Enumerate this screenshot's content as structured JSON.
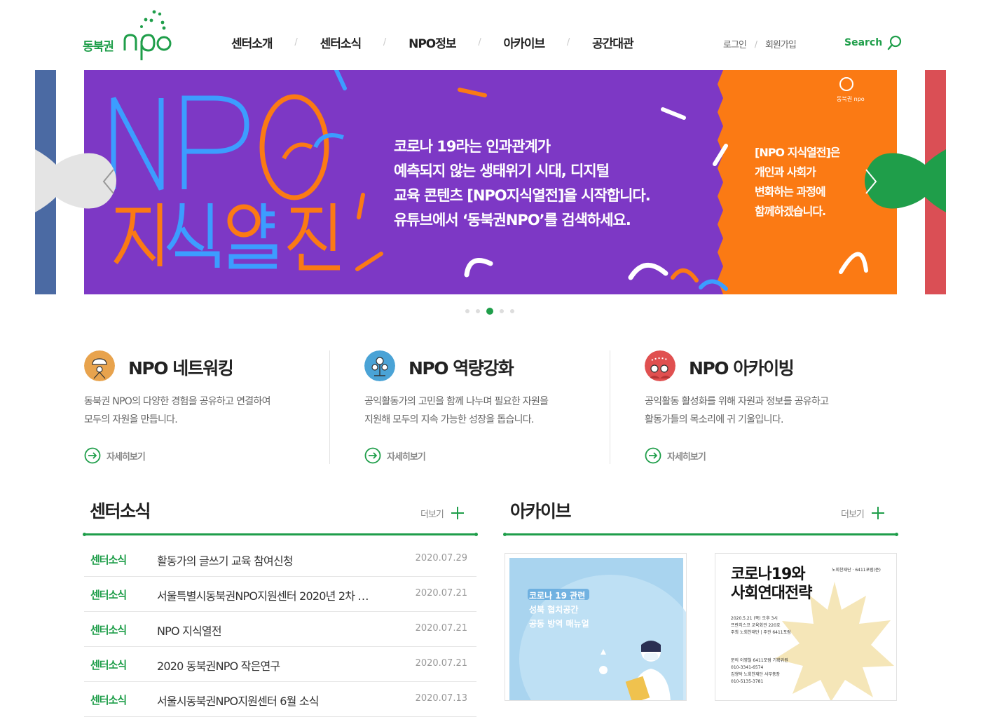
{
  "brand": {
    "logo_korean": "동북권",
    "logo_mark": "npo",
    "accent": "#1f9e4a"
  },
  "nav": {
    "items": [
      "센터소개",
      "센터소식",
      "NPO정보",
      "아카이브",
      "공간대관"
    ],
    "separator": "/"
  },
  "util": {
    "login": "로그인",
    "signup": "회원가입",
    "separator": "/",
    "search": "Search"
  },
  "slider": {
    "headline": "NPO",
    "headline_ko": "지식열전",
    "copy_lines": [
      "코로나 19라는 인과관계가",
      "예측되지 않는 생태위기 시대, 디지털",
      "교육 콘텐츠 [NPO지식열전]을 시작합니다.",
      "유튜브에서 ‘동북권NPO’를 검색하세요."
    ],
    "side_lines": [
      "[NPO 지식열전]은",
      "개인과 사회가",
      "변화하는 과정에",
      "함께하겠습니다."
    ],
    "brand_mark": "동북권 npo",
    "dots_total": 5,
    "active_dot": 3,
    "colors": {
      "purple": "#7d38c5",
      "orange": "#fb7a14",
      "blue": "#3c9dff"
    }
  },
  "features": [
    {
      "title": "NPO 네트워킹",
      "desc": [
        "동북권 NPO의 다양한 경험을 공유하고 연결하여",
        "모두의 자원을 만듭니다."
      ],
      "more": "자세히보기",
      "icon": "networking-icon",
      "color": "#e8a34d"
    },
    {
      "title": "NPO 역량강화",
      "desc": [
        "공익활동가의 고민을 함께 나누며 필요한 자원을",
        "지원해 모두의 지속 가능한 성장을 돕습니다."
      ],
      "more": "자세히보기",
      "icon": "capacity-icon",
      "color": "#4aa3d6"
    },
    {
      "title": "NPO 아카이빙",
      "desc": [
        "공익활동 활성화를 위해 자원과 정보를 공유하고",
        "활동가들의 목소리에 귀 기울입니다."
      ],
      "more": "자세히보기",
      "icon": "archiving-icon",
      "color": "#e05050"
    }
  ],
  "news": {
    "title": "센터소식",
    "more": "더보기",
    "rows": [
      {
        "category": "센터소식",
        "title": "활동가의 글쓰기 교육 참여신청",
        "date": "2020.07.29"
      },
      {
        "category": "센터소식",
        "title": "서울특별시동북권NPO지원센터 2020년 2차 …",
        "date": "2020.07.21"
      },
      {
        "category": "센터소식",
        "title": "NPO 지식열전",
        "date": "2020.07.21"
      },
      {
        "category": "센터소식",
        "title": "2020 동북권NPO 작은연구",
        "date": "2020.07.21"
      },
      {
        "category": "센터소식",
        "title": "서울시동북권NPO지원센터 6월 소식",
        "date": "2020.07.13"
      }
    ]
  },
  "archive": {
    "title": "아카이브",
    "more": "더보기",
    "card1": {
      "lines": [
        "코로나 19 관련",
        "성북 협치공간",
        "공동 방역 매뉴얼"
      ]
    },
    "card2": {
      "title_lines": [
        "코로나19와",
        "사회연대전략"
      ],
      "publisher": "노회찬재단 · 6411포럼(준)",
      "info_lines": [
        "2020.5.21 (목) 오후 3시",
        "프란치스코 교육회관 220호",
        "",
        "주최 노회찬재단 | 주관 6411포럼"
      ],
      "contact_lines": [
        "문의   이영철 6411포럼 기획위원",
        "        010-3341-6574",
        "        김형탁 노회찬재단 사무총장",
        "        010-5135-3781"
      ]
    }
  }
}
